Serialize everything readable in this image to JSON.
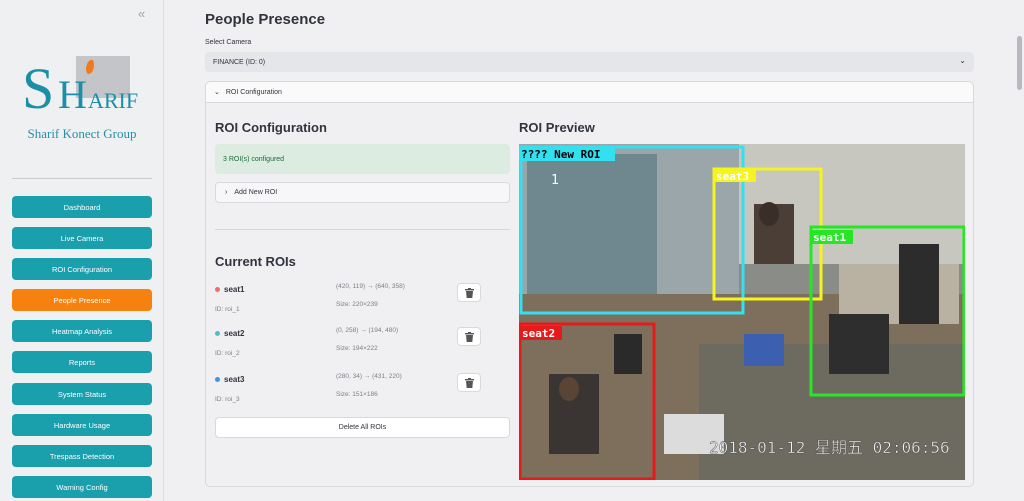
{
  "sidebar": {
    "collapse_icon": "«",
    "logo_text": "Sharif Konect Group",
    "items": [
      {
        "label": "Dashboard",
        "active": false
      },
      {
        "label": "Live Camera",
        "active": false
      },
      {
        "label": "ROI Configuration",
        "active": false
      },
      {
        "label": "People Presence",
        "active": true
      },
      {
        "label": "Heatmap Analysis",
        "active": false
      },
      {
        "label": "Reports",
        "active": false
      },
      {
        "label": "System Status",
        "active": false
      },
      {
        "label": "Hardware Usage",
        "active": false
      },
      {
        "label": "Trespass Detection",
        "active": false
      },
      {
        "label": "Warning Config",
        "active": false
      }
    ]
  },
  "main": {
    "title": "People Presence",
    "select_label": "Select Camera",
    "select_value": "FINANCE (ID: 0)",
    "expander_title": "ROI Configuration",
    "config_heading": "ROI Configuration",
    "status_message": "3 ROI(s) configured",
    "add_roi_label": "Add New ROI",
    "current_heading": "Current ROIs",
    "rois": [
      {
        "name": "seat1",
        "id": "ID: roi_1",
        "coords": "(420, 119) → (640, 358)",
        "size": "Size: 220×239",
        "color": "#f06b6b"
      },
      {
        "name": "seat2",
        "id": "ID: roi_2",
        "coords": "(0, 258) → (194, 480)",
        "size": "Size: 194×222",
        "color": "#4cc3c3"
      },
      {
        "name": "seat3",
        "id": "ID: roi_3",
        "coords": "(280, 34) → (431, 220)",
        "size": "Size: 151×186",
        "color": "#3b9ad9"
      }
    ],
    "delete_all_label": "Delete All ROIs",
    "preview_heading": "ROI Preview",
    "preview": {
      "labels": [
        "???? New ROI",
        "seat3",
        "seat1",
        "seat2"
      ],
      "timestamp": "2018-01-12  星期五  02:06:56",
      "marker": "1",
      "colors": {
        "new_roi": "#33e0f0",
        "seat3": "#f5f51e",
        "seat1": "#26e626",
        "seat2": "#e51a1a"
      }
    }
  },
  "colors": {
    "accent": "#1a9fad",
    "active": "#f7810e",
    "success_bg": "#dcece0"
  }
}
